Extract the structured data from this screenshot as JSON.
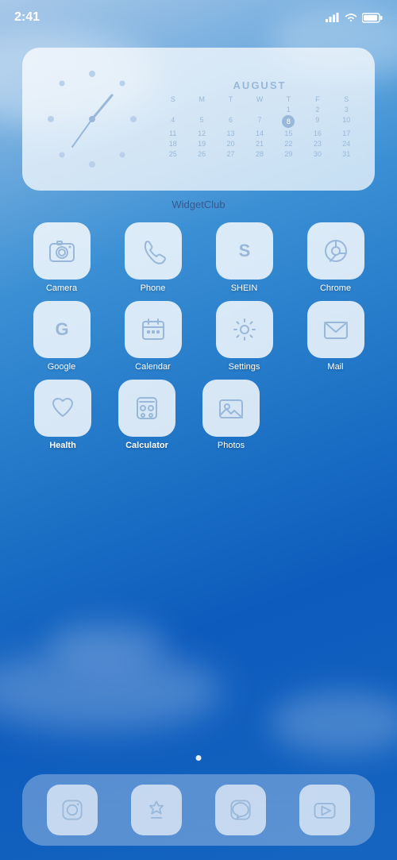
{
  "status": {
    "time": "2:41",
    "signal_icon": "signal-icon",
    "wifi_icon": "wifi-icon",
    "battery_icon": "battery-icon"
  },
  "widget": {
    "label": "WidgetClub",
    "calendar": {
      "month": "AUGUST",
      "days_header": [
        "S",
        "M",
        "T",
        "W",
        "T",
        "F",
        "S"
      ],
      "weeks": [
        [
          "",
          "",
          "",
          "",
          "1",
          "2",
          "3"
        ],
        [
          "4",
          "5",
          "6",
          "7",
          "8",
          "9",
          "10"
        ],
        [
          "11",
          "12",
          "13",
          "14",
          "15",
          "16",
          "17"
        ],
        [
          "18",
          "19",
          "20",
          "21",
          "22",
          "23",
          "24"
        ],
        [
          "25",
          "26",
          "27",
          "28",
          "29",
          "30",
          "31"
        ]
      ],
      "today": "8"
    }
  },
  "apps": {
    "rows": [
      [
        {
          "id": "camera",
          "label": "Camera",
          "bold": false
        },
        {
          "id": "phone",
          "label": "Phone",
          "bold": false
        },
        {
          "id": "shein",
          "label": "SHEIN",
          "bold": false
        },
        {
          "id": "chrome",
          "label": "Chrome",
          "bold": false
        }
      ],
      [
        {
          "id": "google",
          "label": "Google",
          "bold": false
        },
        {
          "id": "calendar",
          "label": "Calendar",
          "bold": false
        },
        {
          "id": "settings",
          "label": "Settings",
          "bold": false
        },
        {
          "id": "mail",
          "label": "Mail",
          "bold": false
        }
      ],
      [
        {
          "id": "health",
          "label": "Health",
          "bold": true
        },
        {
          "id": "calculator",
          "label": "Calculator",
          "bold": true
        },
        {
          "id": "photos",
          "label": "Photos",
          "bold": false
        }
      ]
    ]
  },
  "dock": {
    "items": [
      {
        "id": "instagram",
        "label": "Instagram"
      },
      {
        "id": "appstore",
        "label": "App Store"
      },
      {
        "id": "line",
        "label": "LINE"
      },
      {
        "id": "youtube",
        "label": "YouTube"
      }
    ]
  }
}
